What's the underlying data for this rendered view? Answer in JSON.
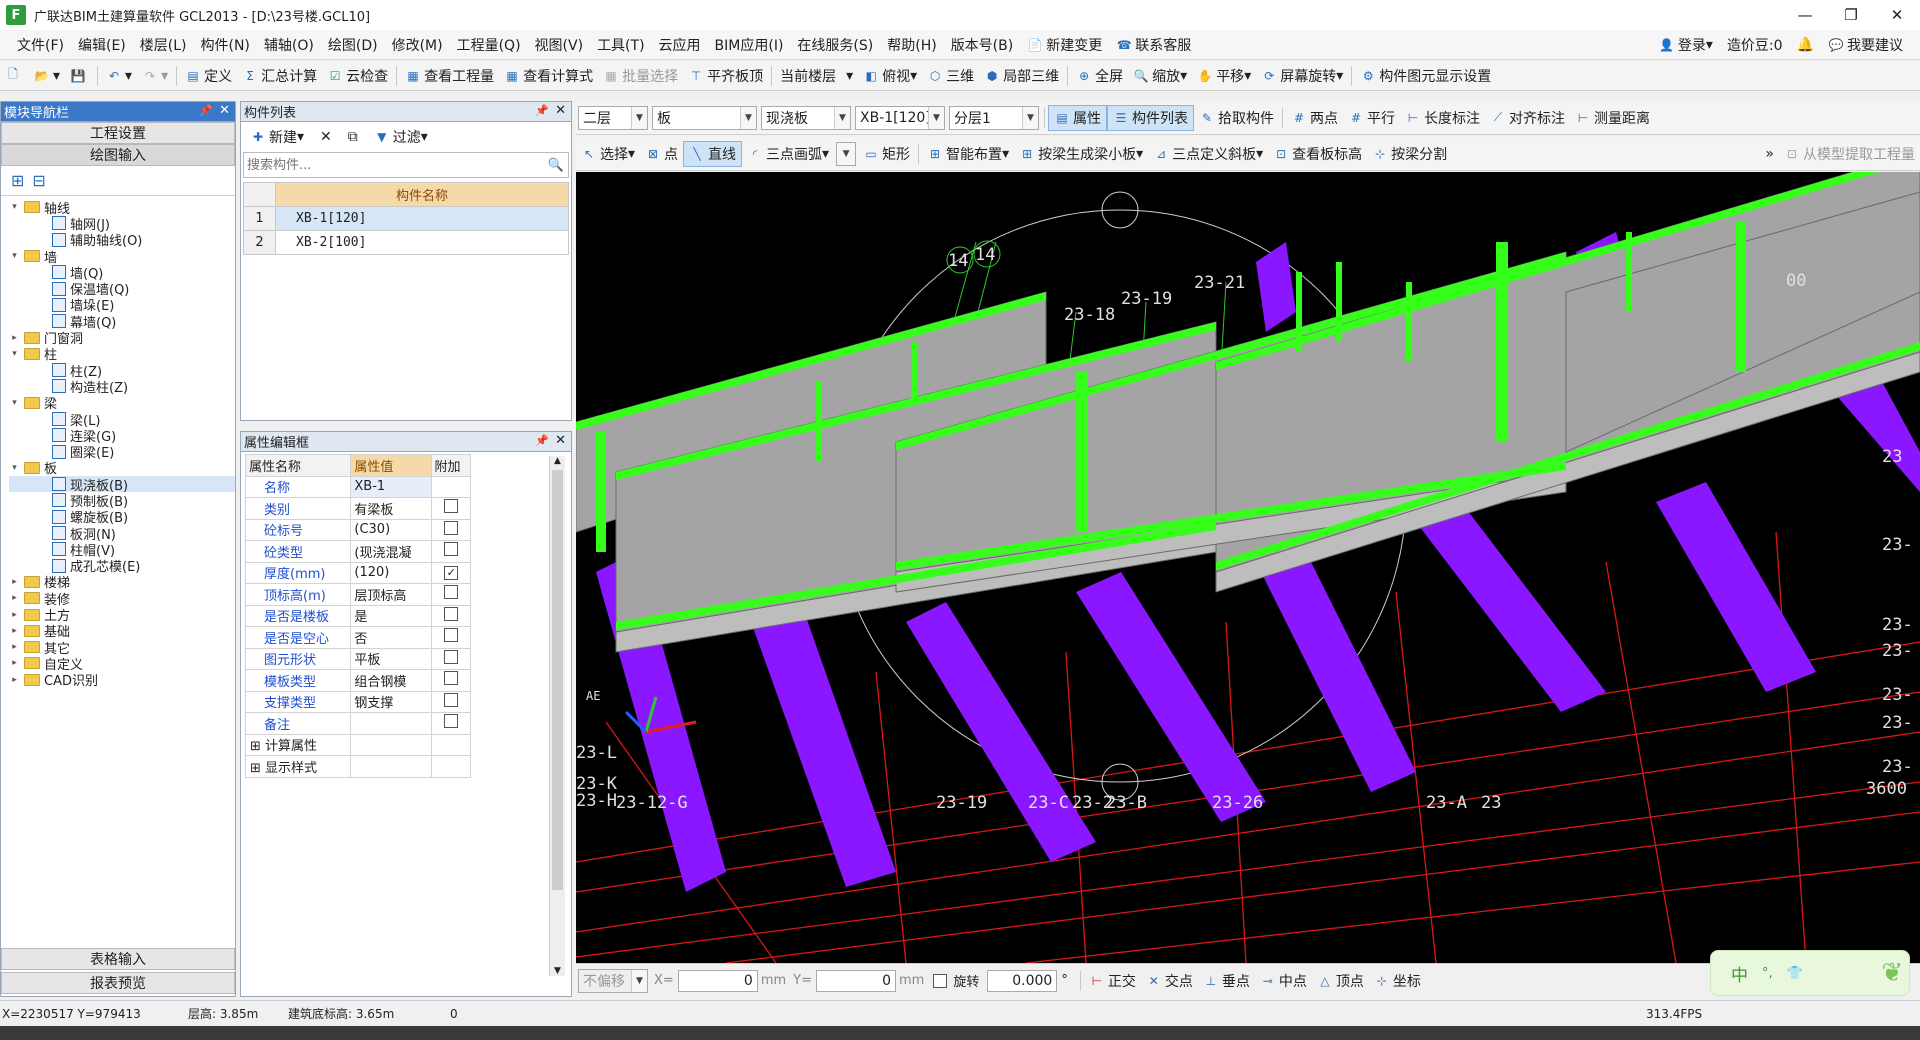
{
  "window": {
    "title": "广联达BIM土建算量软件 GCL2013 - [D:\\23号楼.GCL10]",
    "app_icon": "F"
  },
  "menus": [
    "文件(F)",
    "编辑(E)",
    "楼层(L)",
    "构件(N)",
    "辅轴(O)",
    "绘图(D)",
    "修改(M)",
    "工程量(Q)",
    "视图(V)",
    "工具(T)",
    "云应用",
    "BIM应用(I)",
    "在线服务(S)",
    "帮助(H)",
    "版本号(B)",
    "新建变更",
    "联系客服"
  ],
  "menu_right": {
    "login": "登录",
    "price": "造价豆:0",
    "suggest": "我要建议"
  },
  "toolbar1": [
    "定义",
    "汇总计算",
    "云检查",
    "查看工程量",
    "查看计算式",
    "批量选择",
    "平齐板顶",
    "当前楼层",
    "俯视",
    "三维",
    "局部三维",
    "全屏",
    "缩放",
    "平移",
    "屏幕旋转",
    "构件图元显示设置"
  ],
  "toolbar2": {
    "floor": "二层",
    "category": "板",
    "type": "现浇板",
    "component": "XB-1[120]",
    "layer": "分层1",
    "buttons": [
      "属性",
      "构件列表",
      "拾取构件",
      "两点",
      "平行",
      "长度标注",
      "对齐标注",
      "测量距离"
    ]
  },
  "toolbar3": [
    "选择",
    "点",
    "直线",
    "三点画弧",
    "矩形",
    "智能布置",
    "按梁生成梁小板",
    "三点定义斜板",
    "查看板标高",
    "按梁分割",
    "从模型提取工程量"
  ],
  "nav": {
    "title": "模块导航栏",
    "btn_project": "工程设置",
    "btn_draw": "绘图输入",
    "btn_table": "表格输入",
    "btn_report": "报表预览",
    "tree": [
      {
        "label": "轴线",
        "level": 0,
        "type": "folder",
        "exp": "▾"
      },
      {
        "label": "轴网(J)",
        "level": 1,
        "type": "leaf"
      },
      {
        "label": "辅助轴线(O)",
        "level": 1,
        "type": "leaf"
      },
      {
        "label": "墙",
        "level": 0,
        "type": "folder",
        "exp": "▾"
      },
      {
        "label": "墙(Q)",
        "level": 1,
        "type": "leaf"
      },
      {
        "label": "保温墙(Q)",
        "level": 1,
        "type": "leaf"
      },
      {
        "label": "墙垛(E)",
        "level": 1,
        "type": "leaf"
      },
      {
        "label": "幕墙(Q)",
        "level": 1,
        "type": "leaf"
      },
      {
        "label": "门窗洞",
        "level": 0,
        "type": "folder",
        "exp": "▸"
      },
      {
        "label": "柱",
        "level": 0,
        "type": "folder",
        "exp": "▾"
      },
      {
        "label": "柱(Z)",
        "level": 1,
        "type": "leaf"
      },
      {
        "label": "构造柱(Z)",
        "level": 1,
        "type": "leaf"
      },
      {
        "label": "梁",
        "level": 0,
        "type": "folder",
        "exp": "▾"
      },
      {
        "label": "梁(L)",
        "level": 1,
        "type": "leaf"
      },
      {
        "label": "连梁(G)",
        "level": 1,
        "type": "leaf"
      },
      {
        "label": "圈梁(E)",
        "level": 1,
        "type": "leaf"
      },
      {
        "label": "板",
        "level": 0,
        "type": "folder",
        "exp": "▾"
      },
      {
        "label": "现浇板(B)",
        "level": 1,
        "type": "leaf",
        "selected": true
      },
      {
        "label": "预制板(B)",
        "level": 1,
        "type": "leaf"
      },
      {
        "label": "螺旋板(B)",
        "level": 1,
        "type": "leaf"
      },
      {
        "label": "板洞(N)",
        "level": 1,
        "type": "leaf"
      },
      {
        "label": "柱帽(V)",
        "level": 1,
        "type": "leaf"
      },
      {
        "label": "成孔芯模(E)",
        "level": 1,
        "type": "leaf"
      },
      {
        "label": "楼梯",
        "level": 0,
        "type": "folder",
        "exp": "▸"
      },
      {
        "label": "装修",
        "level": 0,
        "type": "folder",
        "exp": "▸"
      },
      {
        "label": "土方",
        "level": 0,
        "type": "folder",
        "exp": "▸"
      },
      {
        "label": "基础",
        "level": 0,
        "type": "folder",
        "exp": "▸"
      },
      {
        "label": "其它",
        "level": 0,
        "type": "folder",
        "exp": "▸"
      },
      {
        "label": "自定义",
        "level": 0,
        "type": "folder",
        "exp": "▸"
      },
      {
        "label": "CAD识别",
        "level": 0,
        "type": "folder",
        "exp": "▸"
      }
    ]
  },
  "complist": {
    "title": "构件列表",
    "new": "新建",
    "filter": "过滤",
    "search_placeholder": "搜索构件...",
    "col_name": "构件名称",
    "rows": [
      {
        "idx": "1",
        "name": "XB-1[120]"
      },
      {
        "idx": "2",
        "name": "XB-2[100]"
      }
    ]
  },
  "props": {
    "title": "属性编辑框",
    "h_name": "属性名称",
    "h_value": "属性值",
    "h_extra": "附加",
    "rows": [
      {
        "name": "名称",
        "value": "XB-1",
        "chk": null
      },
      {
        "name": "类别",
        "value": "有梁板",
        "chk": false
      },
      {
        "name": "砼标号",
        "value": "(C30)",
        "chk": false
      },
      {
        "name": "砼类型",
        "value": "(现浇混凝",
        "chk": false
      },
      {
        "name": "厚度(mm)",
        "value": "(120)",
        "chk": true
      },
      {
        "name": "顶标高(m)",
        "value": "层顶标高",
        "chk": false
      },
      {
        "name": "是否是楼板",
        "value": "是",
        "chk": false
      },
      {
        "name": "是否是空心",
        "value": "否",
        "chk": false
      },
      {
        "name": "图元形状",
        "value": "平板",
        "chk": false
      },
      {
        "name": "模板类型",
        "value": "组合钢模",
        "chk": false
      },
      {
        "name": "支撑类型",
        "value": "钢支撑",
        "chk": false
      },
      {
        "name": "备注",
        "value": "",
        "chk": false
      }
    ],
    "groups": [
      "计算属性",
      "显示样式"
    ]
  },
  "viewport": {
    "labels": [
      "14",
      "14",
      "23-18",
      "23-19",
      "23-21",
      "00",
      "23-L",
      "23-K",
      "23-H",
      "23-19",
      "23-C",
      "23-2",
      "23-B",
      "23-26",
      "23-A",
      "23-",
      "23-",
      "23-",
      "23-",
      "23-",
      "23-",
      "3600",
      "23-12-G",
      "23",
      "23",
      "AE"
    ]
  },
  "snapbar": {
    "mode": "不偏移",
    "x_label": "X=",
    "x_val": "0",
    "mm1": "mm",
    "y_label": "Y=",
    "y_val": "0",
    "mm2": "mm",
    "rotate": "旋转",
    "rot_val": "0.000",
    "deg": "°",
    "snaps": [
      "正交",
      "交点",
      "垂点",
      "中点",
      "顶点",
      "坐标"
    ],
    "ime": "中"
  },
  "status": {
    "coords": "X=2230517 Y=979413",
    "floor_h": "层高: 3.85m",
    "base_h": "建筑底标高: 3.65m",
    "zero": "0",
    "fps": "313.4FPS"
  },
  "colors": {
    "green": "#35ff1a",
    "purple": "#8a17ff",
    "gray": "#a4a4a4",
    "dark": "#555"
  }
}
